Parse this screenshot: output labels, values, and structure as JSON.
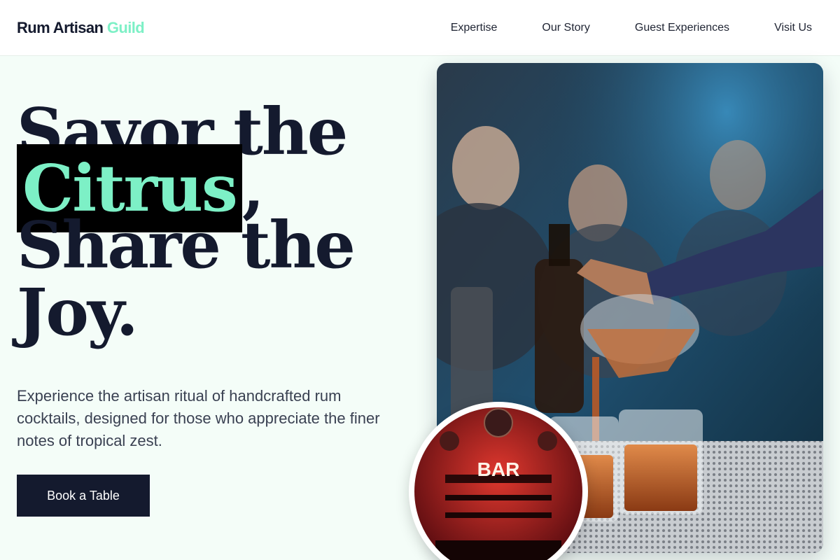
{
  "header": {
    "brand_main": "Rum Artisan",
    "brand_accent": "Guild",
    "nav": [
      "Expertise",
      "Our Story",
      "Guest Experiences",
      "Visit Us"
    ]
  },
  "hero": {
    "headline_line1": "Savor the",
    "headline_highlight": "Citrus",
    "headline_comma": ",",
    "headline_line3": "Share the",
    "headline_line4": "Joy.",
    "subtitle": "Experience the artisan ritual of handcrafted rum cocktails, designed for those who appreciate the finer notes of tropical zest.",
    "cta_label": "Book a Table"
  },
  "images": {
    "main_photo": "bartender-pouring-cocktail-photo",
    "circle_photo": "bar-interior-photo",
    "bar_sign": "BAR"
  },
  "colors": {
    "accent": "#7df0c6",
    "dark": "#141a2e",
    "background": "#f4fdf8"
  }
}
